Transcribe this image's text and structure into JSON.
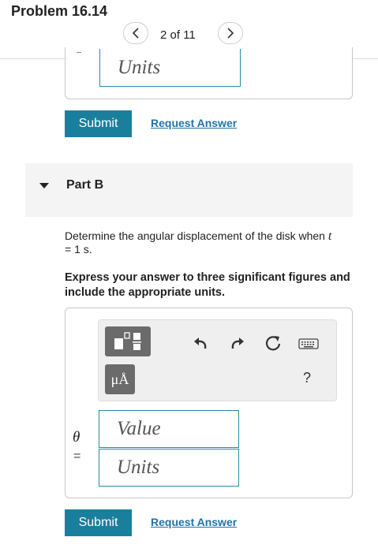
{
  "header": {
    "title": "Problem 16.14",
    "pager": "2 of 11",
    "prev_icon": "chevron-left-icon",
    "next_icon": "chevron-right-icon"
  },
  "part_a": {
    "units_placeholder": "Units",
    "submit_label": "Submit",
    "request_label": "Request Answer"
  },
  "part_b": {
    "label": "Part B",
    "question_pre": "Determine the angular displacement of the disk when ",
    "question_var": "t",
    "question_post": " = 1 s.",
    "instruction": "Express your answer to three significant figures and include the appropriate units.",
    "toolbar": {
      "templates_icon": "templates-icon",
      "units_label": "μÅ",
      "undo_icon": "undo-icon",
      "redo_icon": "redo-icon",
      "reset_icon": "reset-icon",
      "keyboard_icon": "keyboard-icon",
      "help_label": "?"
    },
    "variable": "θ",
    "equals": "=",
    "value_placeholder": "Value",
    "units_placeholder": "Units",
    "submit_label": "Submit",
    "request_label": "Request Answer"
  },
  "colors": {
    "accent": "#1a7f9c",
    "link": "#2273a8",
    "input_border": "#2a8aa3",
    "panel_bg": "#f4f4f4"
  }
}
